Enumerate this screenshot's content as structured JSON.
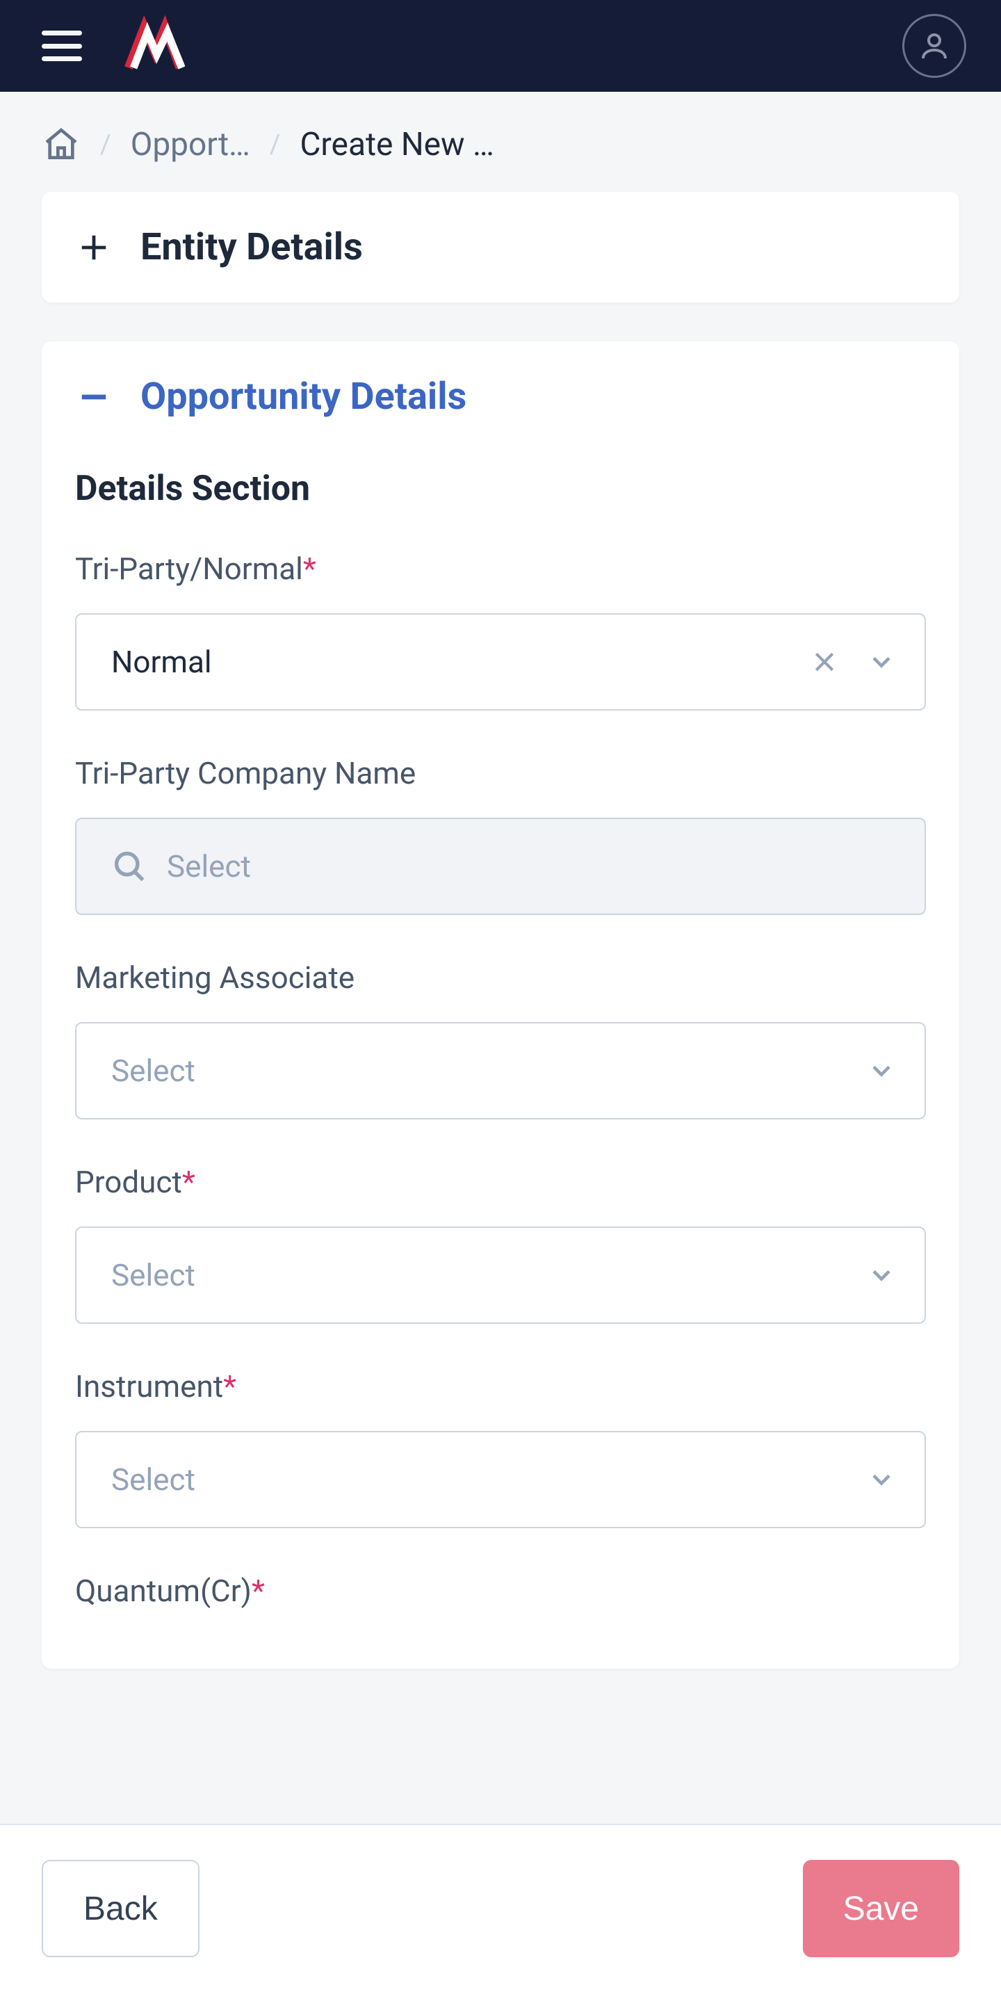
{
  "breadcrumb": {
    "level1": "Opport…",
    "level2": "Create New …"
  },
  "cards": {
    "entity": {
      "title": "Entity Details"
    },
    "opportunity": {
      "title": "Opportunity Details"
    }
  },
  "section_heading": "Details Section",
  "fields": {
    "triparty_normal": {
      "label": "Tri-Party/Normal",
      "required": true,
      "value": "Normal"
    },
    "triparty_company": {
      "label": "Tri-Party Company Name",
      "required": false,
      "placeholder": "Select"
    },
    "marketing_associate": {
      "label": "Marketing Associate",
      "required": false,
      "placeholder": "Select"
    },
    "product": {
      "label": "Product",
      "required": true,
      "placeholder": "Select"
    },
    "instrument": {
      "label": "Instrument",
      "required": true,
      "placeholder": "Select"
    },
    "quantum": {
      "label": "Quantum(Cr)",
      "required": true
    }
  },
  "footer": {
    "back": "Back",
    "save": "Save"
  },
  "required_mark": "*"
}
